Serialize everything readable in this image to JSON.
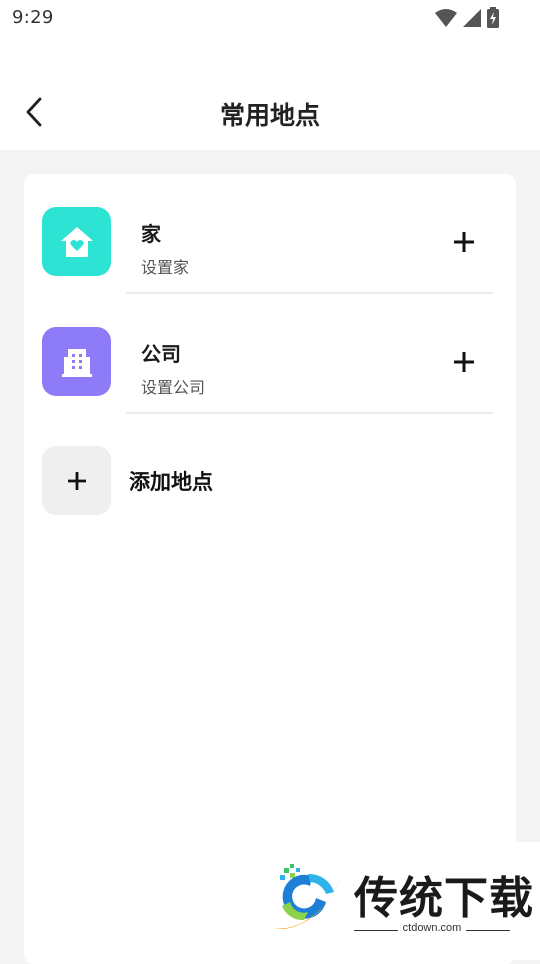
{
  "status_bar": {
    "time": "9:29",
    "icons": [
      "wifi-icon",
      "signal-icon",
      "battery-charging-icon"
    ]
  },
  "header": {
    "back_icon": "chevron-left-icon",
    "title": "常用地点"
  },
  "places": [
    {
      "name": "家",
      "subtitle": "设置家",
      "icon": "home-heart-icon",
      "icon_color": "#2de3d4",
      "action_icon": "plus-icon"
    },
    {
      "name": "公司",
      "subtitle": "设置公司",
      "icon": "building-icon",
      "icon_color": "#8e7bf7",
      "action_icon": "plus-icon"
    }
  ],
  "add_place": {
    "label": "添加地点",
    "icon": "plus-icon"
  },
  "watermark": {
    "brand": "传统下载",
    "url": "ctdown.com"
  }
}
